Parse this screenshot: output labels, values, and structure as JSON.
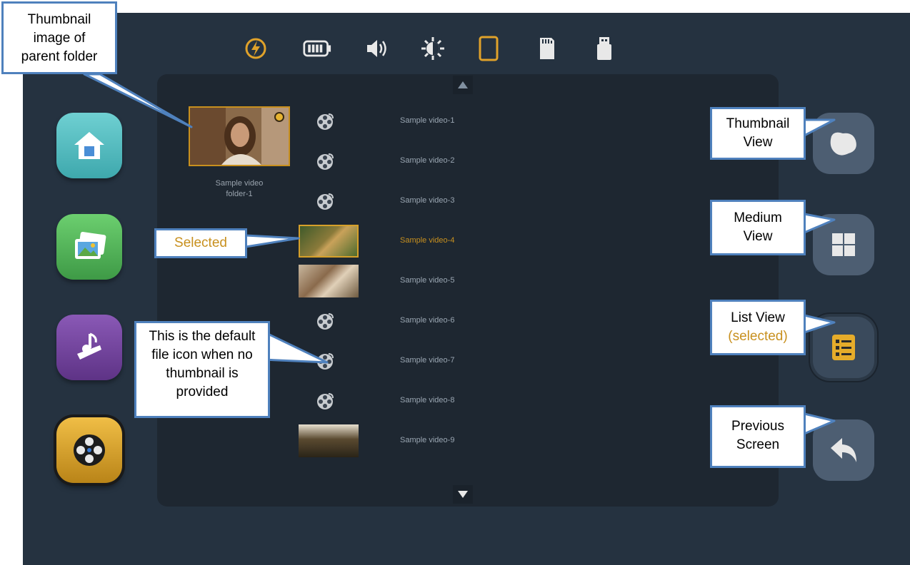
{
  "status_bar": [
    {
      "icon": "lightning-icon",
      "color": "#e0a22a"
    },
    {
      "icon": "battery-icon",
      "color": "#e8e8e8"
    },
    {
      "icon": "speaker-icon",
      "color": "#e8e8e8"
    },
    {
      "icon": "brightness-icon",
      "color": "#e8e8e8"
    },
    {
      "icon": "tablet-icon",
      "color": "#e0a22a"
    },
    {
      "icon": "sd-card-icon",
      "color": "#e8e8e8"
    },
    {
      "icon": "usb-drive-icon",
      "color": "#e8e8e8"
    }
  ],
  "launcher": [
    {
      "icon": "home-icon",
      "color": "#5cc3c6"
    },
    {
      "icon": "gallery-icon",
      "color": "#55b35c"
    },
    {
      "icon": "music-icon",
      "color": "#7b4aa6"
    },
    {
      "icon": "video-reel-icon",
      "color": "#d9a02c"
    }
  ],
  "folder": {
    "label_line1": "Sample video",
    "label_line2": "folder-1"
  },
  "videos": [
    "Sample video-1",
    "Sample video-2",
    "Sample video-3",
    "Sample video-4",
    "Sample video-5",
    "Sample video-6",
    "Sample video-7",
    "Sample video-8",
    "Sample video-9"
  ],
  "view_buttons": [
    {
      "name": "thumbnail-view-button",
      "icon": "thumbnail-view-icon"
    },
    {
      "name": "medium-view-button",
      "icon": "grid-icon"
    },
    {
      "name": "list-view-button",
      "icon": "list-icon",
      "selected": true
    },
    {
      "name": "previous-screen-button",
      "icon": "back-arrow-icon"
    }
  ],
  "callouts": {
    "parent_folder": [
      "Thumbnail",
      "image of",
      "parent folder"
    ],
    "selected": "Selected",
    "default_icon": [
      "This is the default",
      "file icon when no",
      "thumbnail is",
      "provided"
    ],
    "thumbnail_view": [
      "Thumbnail",
      "View"
    ],
    "medium_view": [
      "Medium",
      "View"
    ],
    "list_view": [
      "List View",
      "(selected)"
    ],
    "previous_screen": [
      "Previous",
      "Screen"
    ]
  },
  "colors": {
    "screen_bg": "#253240",
    "panel_bg": "#1e2731",
    "accent_gold": "#c8901e",
    "callout_border": "#4f81bd"
  }
}
